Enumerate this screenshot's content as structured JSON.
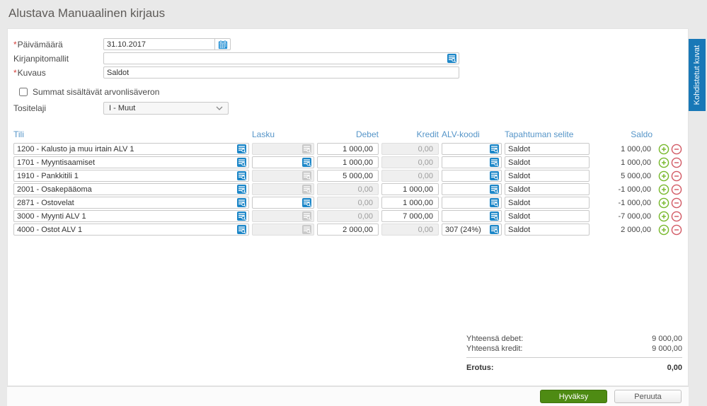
{
  "page_title": "Alustava Manuaalinen kirjaus",
  "side_tab": {
    "label": "Kohdistetut kuvat"
  },
  "required_marker": "*",
  "form": {
    "date": {
      "label": "Päivämäärä",
      "required": true,
      "value": "31.10.2017"
    },
    "templates": {
      "label": "Kirjanpitomallit",
      "value": "",
      "placeholder": ""
    },
    "description": {
      "label": "Kuvaus",
      "required": true,
      "value": "Saldot"
    },
    "vat_checkbox": {
      "label": "Summat sisältävät arvonlisäveron",
      "checked": false
    },
    "voucher_type": {
      "label": "Tositelaji",
      "value": "I - Muut"
    }
  },
  "table": {
    "headers": {
      "account": "Tili",
      "invoice": "Lasku",
      "debit": "Debet",
      "credit": "Kredit",
      "vat": "ALV-koodi",
      "description": "Tapahtuman selite",
      "balance": "Saldo"
    },
    "rows": [
      {
        "account": "1200 - Kalusto ja muu irtain ALV 1",
        "invoice": "",
        "invoice_enabled": false,
        "debit": "1 000,00",
        "debit_enabled": true,
        "credit": "0,00",
        "credit_enabled": false,
        "vat": "",
        "description": "Saldot",
        "balance": "1 000,00"
      },
      {
        "account": "1701 - Myyntisaamiset",
        "invoice": "",
        "invoice_enabled": true,
        "debit": "1 000,00",
        "debit_enabled": true,
        "credit": "0,00",
        "credit_enabled": false,
        "vat": "",
        "description": "Saldot",
        "balance": "1 000,00"
      },
      {
        "account": "1910 - Pankkitili 1",
        "invoice": "",
        "invoice_enabled": false,
        "debit": "5 000,00",
        "debit_enabled": true,
        "credit": "0,00",
        "credit_enabled": false,
        "vat": "",
        "description": "Saldot",
        "balance": "5 000,00"
      },
      {
        "account": "2001 - Osakepääoma",
        "invoice": "",
        "invoice_enabled": false,
        "debit": "0,00",
        "debit_enabled": false,
        "credit": "1 000,00",
        "credit_enabled": true,
        "vat": "",
        "description": "Saldot",
        "balance": "-1 000,00"
      },
      {
        "account": "2871 - Ostovelat",
        "invoice": "",
        "invoice_enabled": true,
        "debit": "0,00",
        "debit_enabled": false,
        "credit": "1 000,00",
        "credit_enabled": true,
        "vat": "",
        "description": "Saldot",
        "balance": "-1 000,00"
      },
      {
        "account": "3000 - Myynti ALV 1",
        "invoice": "",
        "invoice_enabled": false,
        "debit": "0,00",
        "debit_enabled": false,
        "credit": "7 000,00",
        "credit_enabled": true,
        "vat": "",
        "description": "Saldot",
        "balance": "-7 000,00"
      },
      {
        "account": "4000 - Ostot ALV 1",
        "invoice": "",
        "invoice_enabled": false,
        "debit": "2 000,00",
        "debit_enabled": true,
        "credit": "0,00",
        "credit_enabled": false,
        "vat": "307 (24%)",
        "description": "Saldot",
        "balance": "2 000,00"
      }
    ]
  },
  "totals": {
    "debit_label": "Yhteensä debet:",
    "debit_value": "9 000,00",
    "credit_label": "Yhteensä kredit:",
    "credit_value": "9 000,00",
    "difference_label": "Erotus:",
    "difference_value": "0,00"
  },
  "footer": {
    "approve_label": "Hyväksy",
    "cancel_label": "Peruuta"
  },
  "icons": {
    "date_picker": "calendar-icon",
    "lookup": "table-search-icon",
    "select_arrow": "chevron-down-icon",
    "add_row": "plus-circle-icon",
    "remove_row": "minus-circle-icon"
  },
  "colors": {
    "accent_blue": "#1d87c8",
    "header_blue": "#5695c8",
    "tab_blue": "#1878b7",
    "approve_green": "#4e8b13",
    "add_green": "#76b82a",
    "remove_red": "#d25964",
    "required_red": "#d43f3a"
  }
}
